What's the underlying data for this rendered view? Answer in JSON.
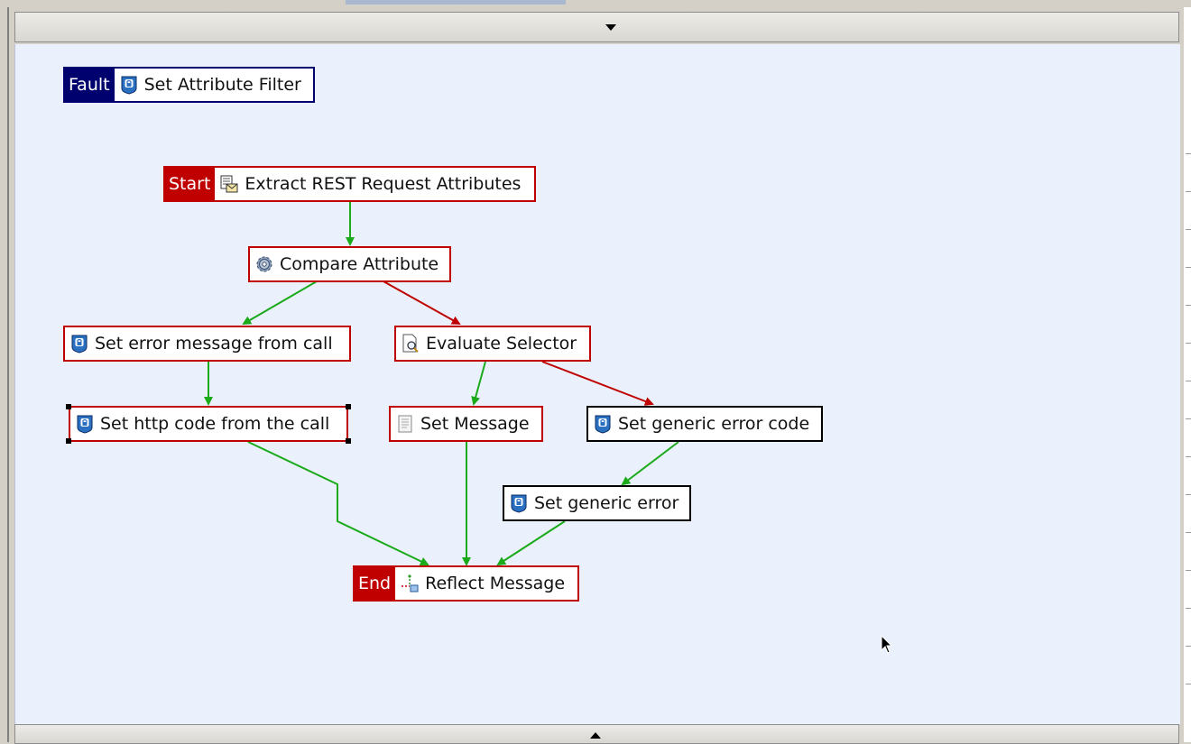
{
  "canvas": {
    "fault_tag": "Fault",
    "start_tag": "Start",
    "end_tag": "End"
  },
  "nodes": {
    "set_attribute_filter": "Set Attribute Filter",
    "extract_rest": "Extract REST Request Attributes",
    "compare_attribute": "Compare Attribute",
    "set_error_message": "Set error message from call",
    "evaluate_selector": "Evaluate Selector",
    "set_http_code": "Set http code from the call",
    "set_message": "Set Message",
    "set_generic_error_code": "Set generic error code",
    "set_generic_error": "Set generic error",
    "reflect_message": "Reflect Message"
  },
  "colors": {
    "success_path": "#1aaa1a",
    "failure_path": "#c00000",
    "canvas_bg": "#eaf1fc"
  },
  "icons": [
    "shield-icon",
    "extract-icon",
    "gear-icon",
    "selector-icon",
    "message-icon",
    "reflect-icon",
    "collapse-down-icon",
    "collapse-up-icon",
    "mouse-cursor-icon"
  ]
}
